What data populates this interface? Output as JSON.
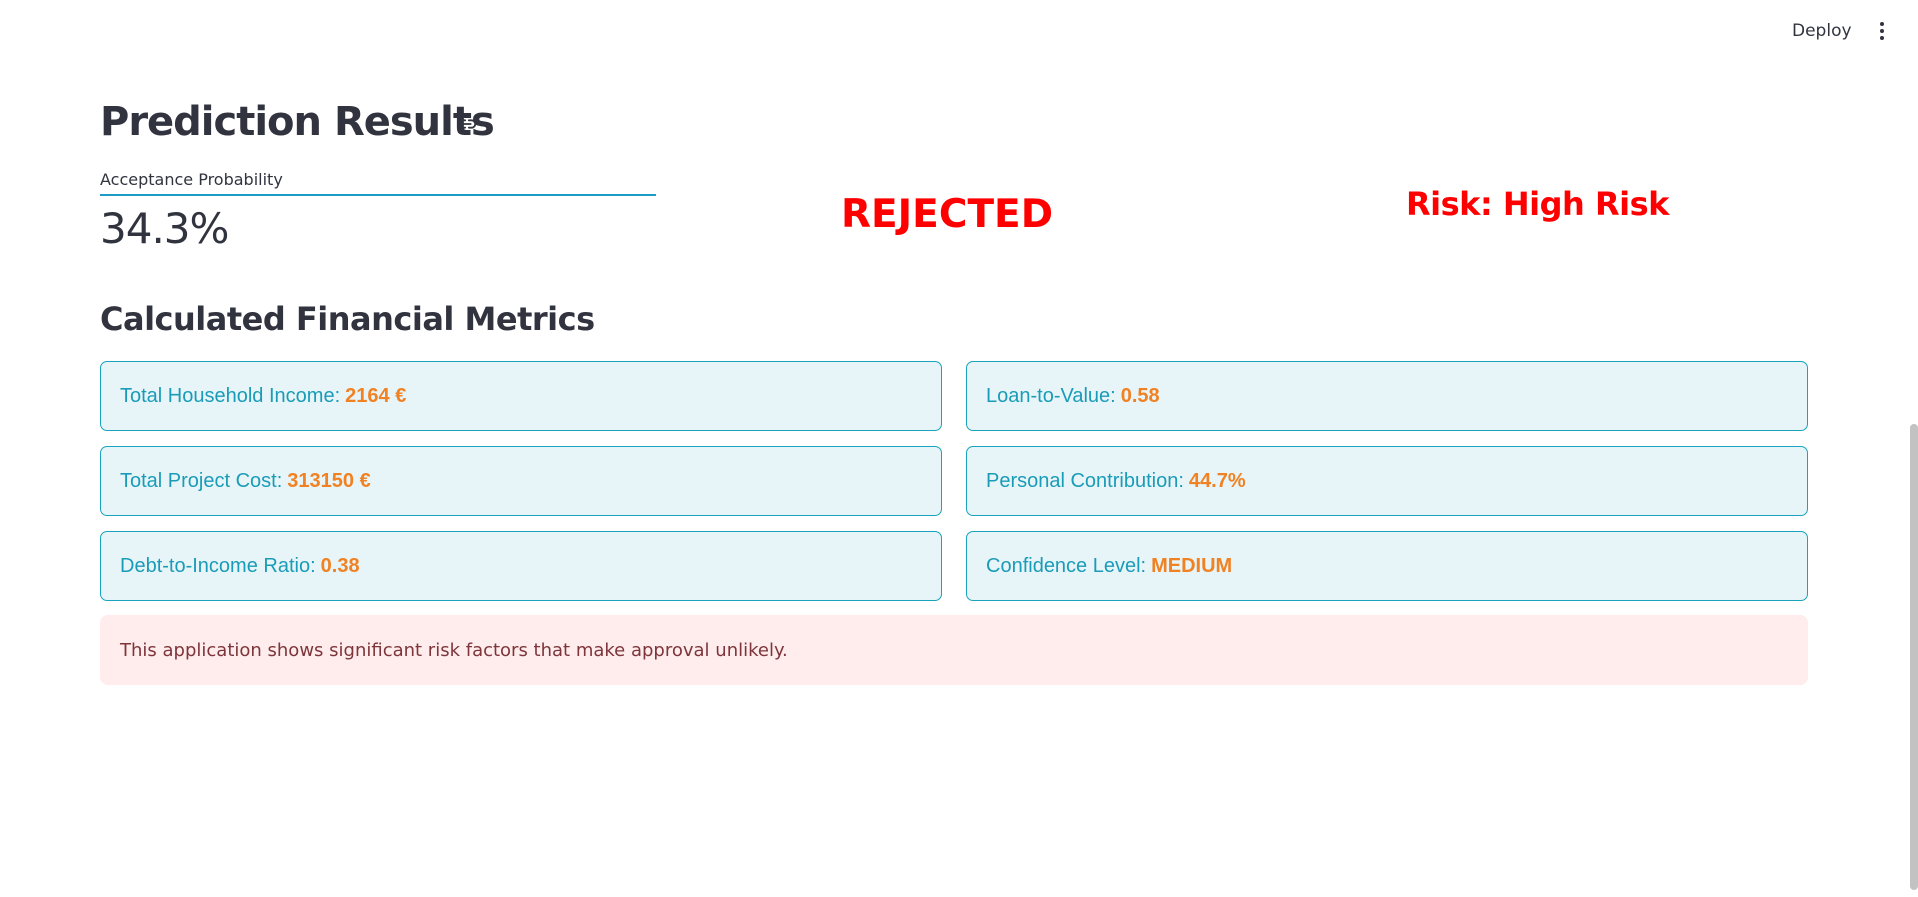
{
  "header": {
    "deploy_label": "Deploy",
    "menu_icon": "vertical-ellipsis-icon"
  },
  "main": {
    "title": "Prediction Results",
    "title_link_icon": "link-icon",
    "acceptance": {
      "label": "Acceptance Probability",
      "value": "34.3%"
    },
    "decision": "REJECTED",
    "risk": "Risk: High Risk",
    "metrics_heading": "Calculated Financial Metrics",
    "metrics": [
      {
        "label": "Total Household Income:",
        "value": "2164 €"
      },
      {
        "label": "Loan-to-Value:",
        "value": "0.58"
      },
      {
        "label": "Total Project Cost:",
        "value": "313150 €"
      },
      {
        "label": "Personal Contribution:",
        "value": "44.7%"
      },
      {
        "label": "Debt-to-Income Ratio:",
        "value": "0.38"
      },
      {
        "label": "Confidence Level:",
        "value": "MEDIUM"
      }
    ],
    "alert_message": "This application shows significant risk factors that make approval unlikely."
  },
  "colors": {
    "accent_red": "#ff0000",
    "card_border": "#1aa3bd",
    "card_background": "#e7f5f8",
    "card_label": "#1a9cb8",
    "card_value": "#f08224",
    "alert_background": "#ffecec",
    "alert_text": "#7d353b"
  }
}
